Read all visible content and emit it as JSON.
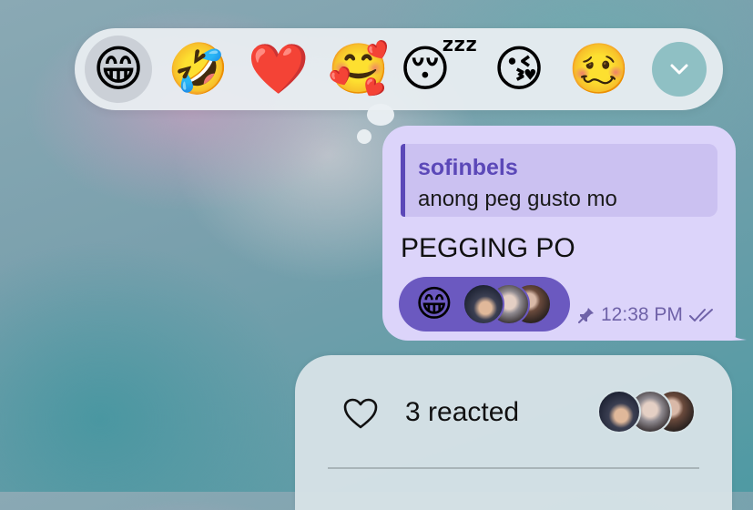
{
  "reaction_picker": {
    "options": [
      {
        "emoji": "😁",
        "name": "grinning-face-with-smiling-eyes",
        "selected": true
      },
      {
        "emoji": "🤣",
        "name": "rolling-on-the-floor-laughing",
        "selected": false
      },
      {
        "emoji": "❤️",
        "name": "red-heart",
        "selected": false
      },
      {
        "emoji": "🥰",
        "name": "smiling-face-with-hearts",
        "selected": false
      },
      {
        "emoji": "😴",
        "name": "sleeping-face",
        "selected": false
      },
      {
        "emoji": "😘",
        "name": "face-blowing-a-kiss",
        "selected": false
      },
      {
        "emoji": "🥴",
        "name": "woozy-face",
        "selected": false
      }
    ],
    "expand_icon": "chevron-down-icon"
  },
  "message": {
    "reply_to": {
      "sender": "sofinbels",
      "text": "anong peg gusto mo"
    },
    "text": "PEGGING PO",
    "reaction": {
      "emoji": "😁",
      "avatar_count": 3
    },
    "time": "12:38 PM",
    "pinned_icon": "pin-icon",
    "status_icon": "double-check-icon"
  },
  "reactions_panel": {
    "icon": "heart-outline-icon",
    "label": "3 reacted",
    "avatar_count": 3
  },
  "colors": {
    "bubble": "#dcd4fa",
    "accent": "#5b48b8",
    "reaction_pill": "#6b59c0",
    "picker_bg": "#ebf0f3",
    "expand_button": "#8fc0c4"
  }
}
